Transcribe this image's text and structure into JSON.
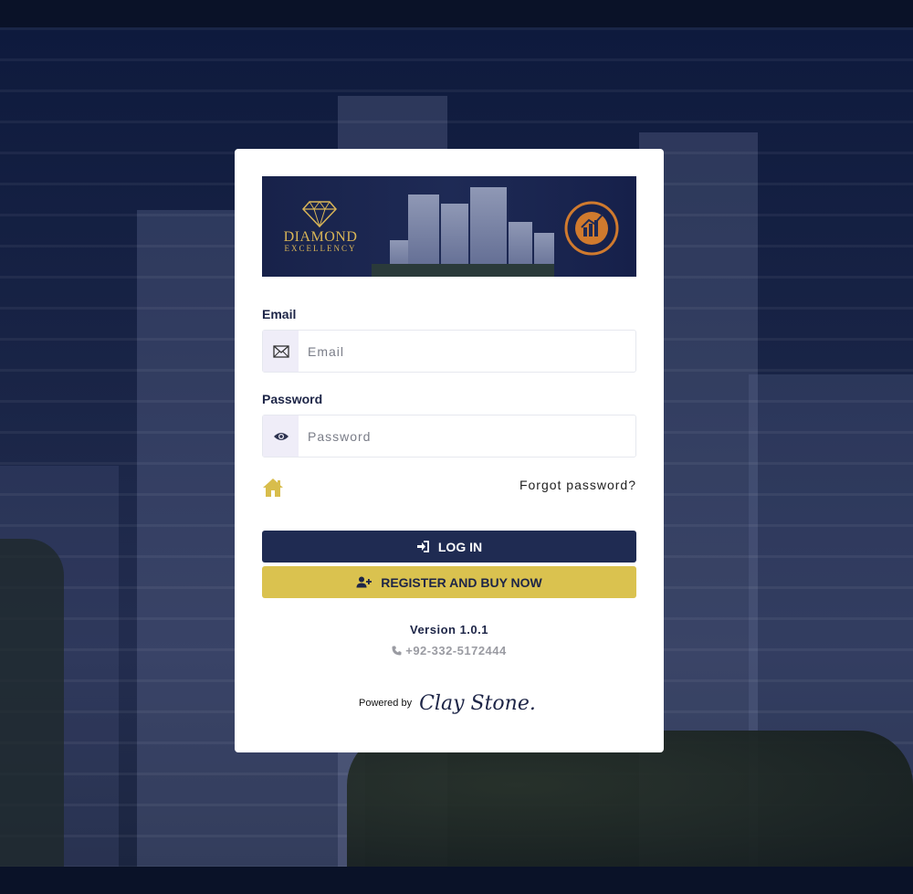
{
  "login_form": {
    "email_label": "Email",
    "email_placeholder": "Email",
    "email_value": "",
    "password_label": "Password",
    "password_placeholder": "Password",
    "password_value": "",
    "forgot_password": "Forgot password?",
    "login_button": "LOG IN",
    "register_button": "REGISTER AND BUY NOW"
  },
  "banner": {
    "brand_line1": "DIAMOND",
    "brand_line2": "EXCELLENCY"
  },
  "footer": {
    "version": "Version 1.0.1",
    "phone": "+92-332-5172444",
    "powered_by": "Powered by",
    "company": "Clay Stone."
  },
  "icons": {
    "email": "envelope-icon",
    "password": "eye-icon",
    "home": "home-icon",
    "login": "sign-in-icon",
    "register": "user-plus-icon",
    "phone": "phone-icon"
  },
  "colors": {
    "primary": "#1f2b52",
    "accent": "#dac24f",
    "background": "#0b1430",
    "addon": "#efedf8"
  }
}
